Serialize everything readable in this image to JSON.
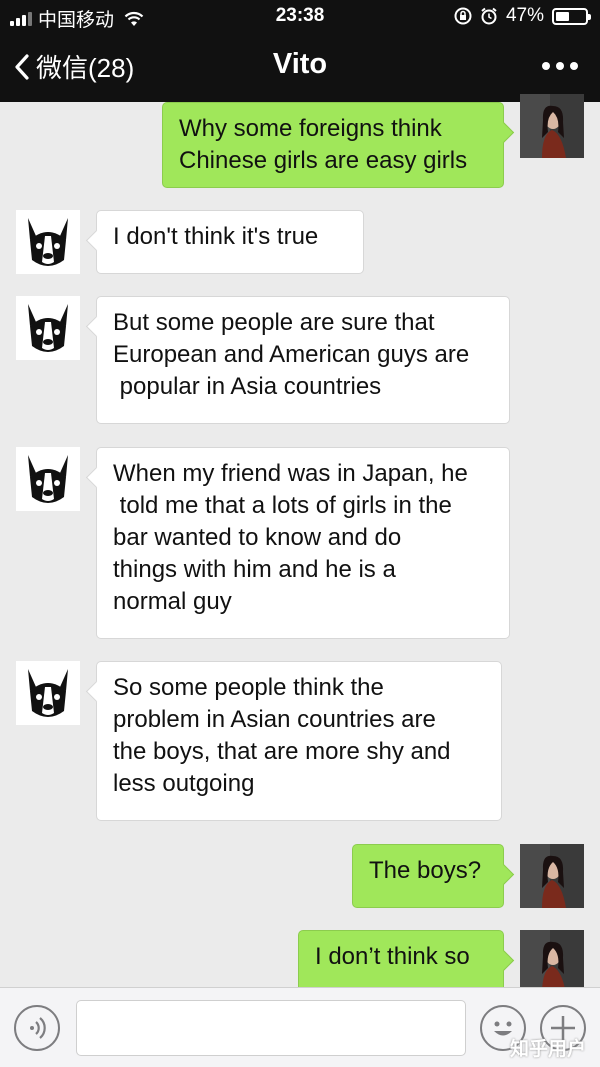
{
  "status_bar": {
    "carrier": "中国移动",
    "time": "23:38",
    "battery": "47%",
    "battery_level": 0.47
  },
  "nav": {
    "back_label": "微信(28)",
    "title": "Vito",
    "more_icon": "more-dots-icon"
  },
  "messages": [
    {
      "side": "out",
      "sender": "me",
      "text": "Why some foreigns think\nChinese girls are easy girls"
    },
    {
      "side": "in",
      "sender": "Vito",
      "text": "I don't think it's true"
    },
    {
      "side": "in",
      "sender": "Vito",
      "text": "But some people are sure that\nEuropean and American guys are\n popular in Asia countries"
    },
    {
      "side": "in",
      "sender": "Vito",
      "text": "When my friend was in Japan, he\n told me that a lots of girls in the\nbar wanted to know and do\nthings with him and he is a\nnormal guy"
    },
    {
      "side": "in",
      "sender": "Vito",
      "text": "So some people think the\nproblem in Asian countries are\nthe boys, that are more shy and\nless outgoing"
    },
    {
      "side": "out",
      "sender": "me",
      "text": "The boys?"
    },
    {
      "side": "out",
      "sender": "me",
      "text": "I don’t think so"
    }
  ],
  "input_bar": {
    "voice_icon": "voice-icon",
    "emoji_icon": "emoji-icon",
    "plus_icon": "plus-icon"
  },
  "watermark": "知乎用户",
  "colors": {
    "outgoing_bubble": "#a0e75a",
    "incoming_bubble": "#ffffff",
    "chat_background": "#ebebeb",
    "header": "#111111"
  }
}
